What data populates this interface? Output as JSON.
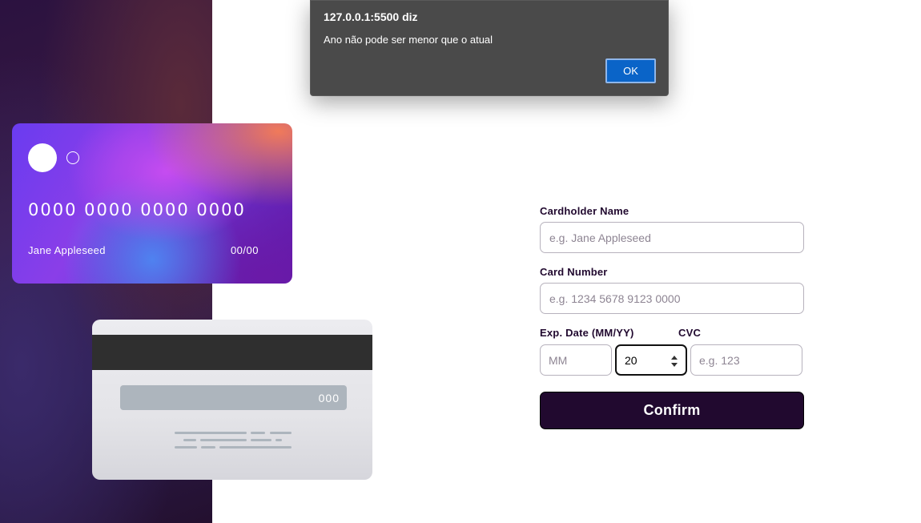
{
  "alert": {
    "title": "127.0.0.1:5500 diz",
    "message": "Ano não pode ser menor que o atual",
    "ok_label": "OK"
  },
  "card_front": {
    "number": "0000 0000 0000 0000",
    "name": "Jane Appleseed",
    "exp": "00/00"
  },
  "card_back": {
    "cvc": "000"
  },
  "form": {
    "name_label": "Cardholder Name",
    "name_placeholder": "e.g. Jane Appleseed",
    "number_label": "Card Number",
    "number_placeholder": "e.g. 1234 5678 9123 0000",
    "exp_label": "Exp. Date (MM/YY)",
    "cvc_label": "CVC",
    "mm_placeholder": "MM",
    "yy_value": "20",
    "cvc_placeholder": "e.g. 123",
    "confirm_label": "Confirm"
  },
  "colors": {
    "dark_violet": "#21092f",
    "alert_bg": "#4a4a4a",
    "ok_blue": "#0a64c8"
  }
}
